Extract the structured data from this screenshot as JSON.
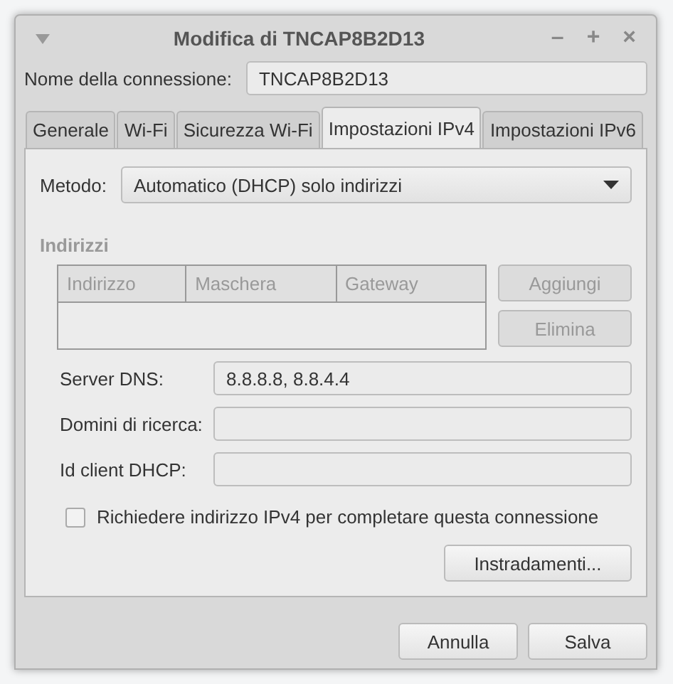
{
  "window": {
    "title": "Modifica di TNCAP8B2D13",
    "controls": [
      "–",
      "+",
      "×"
    ]
  },
  "connection_name": {
    "label": "Nome della connessione:",
    "value": "TNCAP8B2D13"
  },
  "tabs": [
    {
      "label": "Generale",
      "selected": false
    },
    {
      "label": "Wi-Fi",
      "selected": false
    },
    {
      "label": "Sicurezza Wi-Fi",
      "selected": false
    },
    {
      "label": "Impostazioni IPv4",
      "selected": true
    },
    {
      "label": "Impostazioni IPv6",
      "selected": false
    }
  ],
  "method": {
    "label": "Metodo:",
    "value": "Automatico (DHCP) solo indirizzi"
  },
  "addresses": {
    "title": "Indirizzi",
    "disabled": true,
    "columns": [
      "Indirizzo",
      "Maschera",
      "Gateway"
    ],
    "buttons": [
      {
        "label": "Aggiungi",
        "disabled": true
      },
      {
        "label": "Elimina",
        "disabled": true
      }
    ]
  },
  "fields": [
    {
      "label": "Server DNS:",
      "value": "8.8.8.8, 8.8.4.4"
    },
    {
      "label": "Domini di ricerca:"
    },
    {
      "label": "Id client DHCP:"
    }
  ],
  "require_ipv4": {
    "label": "Richiedere indirizzo IPv4 per completare questa connessione",
    "checked": false
  },
  "routes_button": "Instradamenti...",
  "buttons": [
    "Annulla",
    "Salva"
  ]
}
